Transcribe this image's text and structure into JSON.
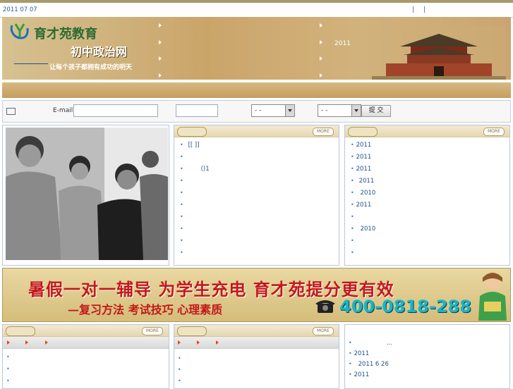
{
  "header": {
    "date": "2011 07 07",
    "top_links": [
      "|",
      "|"
    ]
  },
  "banner": {
    "logo_text": "育才苑教育",
    "site_name": "初中政治网",
    "slogan": "让每个孩子都拥有成功的明天",
    "year": "2011"
  },
  "search": {
    "email_label": "E-mail",
    "select1_value": "- -",
    "select2_value": "- -",
    "submit_label": "提 交"
  },
  "panels": {
    "more_label": "MORE",
    "middle_items": [
      "[[    ]]",
      "",
      "()1",
      "",
      "",
      "",
      "",
      "",
      "",
      ""
    ],
    "right_items": [
      "2011",
      "2011",
      "2011",
      "2011",
      "2010",
      "2011",
      "",
      "2010",
      "",
      ""
    ]
  },
  "ad": {
    "headline": "暑假一对一辅导 为学生充电 育才苑提分更有效",
    "subline": "—复习方法 考试技巧 心理素质",
    "phone": "400-0818-288"
  },
  "bottom": {
    "right_items": [
      "...",
      "2011",
      "2011    6 26",
      "2011"
    ]
  },
  "colors": {
    "accent": "#1d4f8a",
    "banner": "#caa56a",
    "ad_red": "#c21818",
    "phone": "#17b6c7"
  }
}
